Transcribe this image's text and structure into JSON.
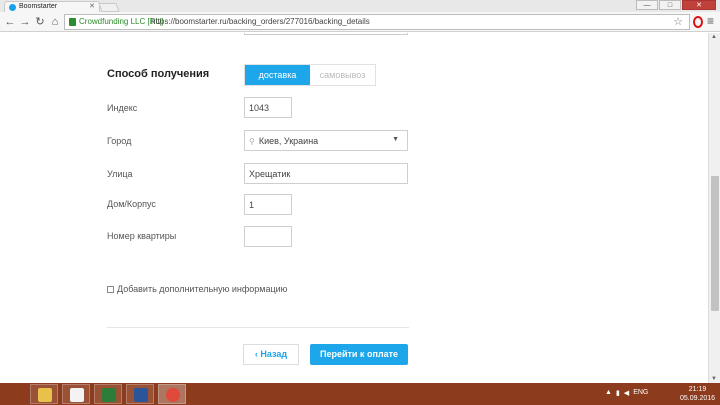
{
  "browser": {
    "tab_title": "Boomstarter",
    "ev_badge": "Crowdfunding LLC [RU]",
    "url": "https://boomstarter.ru/backing_orders/277016/backing_details",
    "window_buttons": {
      "minimize": "—",
      "maximize": "□",
      "close": "✕"
    }
  },
  "form": {
    "section_title": "Способ получения",
    "delivery_options": [
      {
        "label": "доставка",
        "selected": true
      },
      {
        "label": "самовывоз",
        "selected": false
      }
    ],
    "fields": {
      "index": {
        "label": "Индекс",
        "value": "1043"
      },
      "city": {
        "label": "Город",
        "value": "Киев, Украина"
      },
      "street": {
        "label": "Улица",
        "value": "Хрещатик"
      },
      "house": {
        "label": "Дом/Корпус",
        "value": "1"
      },
      "apartment": {
        "label": "Номер квартиры",
        "value": ""
      }
    },
    "extra_info_label": "Добавить дополнительную информацию",
    "back_label": "Назад",
    "pay_label": "Перейти к оплате"
  },
  "taskbar": {
    "language": "ENG",
    "time": "21:19",
    "date": "05.09.2016"
  },
  "colors": {
    "accent": "#1da6ea",
    "taskbar": "#8c3b1c"
  }
}
